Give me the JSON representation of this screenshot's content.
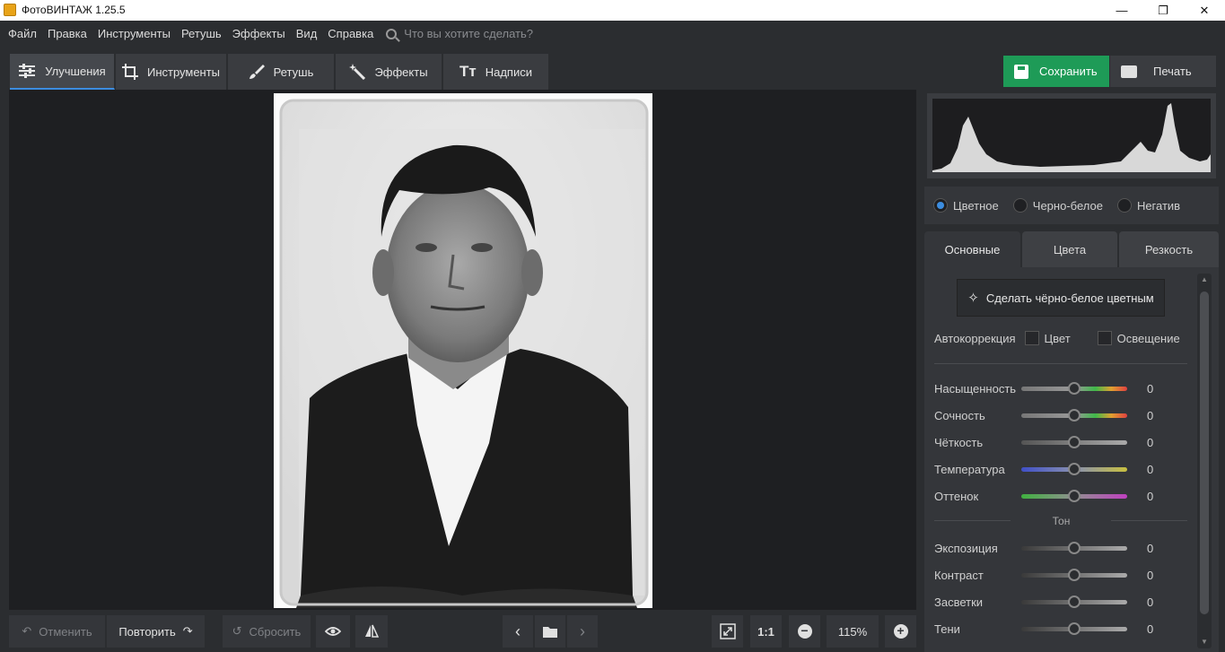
{
  "window": {
    "title": "ФотоВИНТАЖ 1.25.5",
    "min_label": "—",
    "max_label": "❐",
    "close_label": "✕"
  },
  "menu": {
    "items": [
      "Файл",
      "Правка",
      "Инструменты",
      "Ретушь",
      "Эффекты",
      "Вид",
      "Справка"
    ],
    "search_placeholder": "Что вы хотите сделать?"
  },
  "tabs": [
    {
      "label": "Улучшения",
      "icon": "sliders-icon"
    },
    {
      "label": "Инструменты",
      "icon": "crop-icon"
    },
    {
      "label": "Ретушь",
      "icon": "brush-icon"
    },
    {
      "label": "Эффекты",
      "icon": "magic-wand-icon"
    },
    {
      "label": "Надписи",
      "icon": "text-icon"
    }
  ],
  "actions": {
    "save": "Сохранить",
    "print": "Печать"
  },
  "bottom": {
    "undo": "Отменить",
    "redo": "Повторить",
    "reset": "Сбросить",
    "ratio": "1:1",
    "zoom": "115%"
  },
  "color_mode": {
    "options": [
      "Цветное",
      "Черно-белое",
      "Негатив"
    ],
    "selected": "Цветное"
  },
  "panel_tabs": [
    "Основные",
    "Цвета",
    "Резкость"
  ],
  "colorize_button": "Сделать чёрно-белое цветным",
  "autocorrection": {
    "label": "Автокоррекция",
    "color": "Цвет",
    "light": "Освещение"
  },
  "sliders_main": [
    {
      "label": "Насыщенность",
      "value": "0"
    },
    {
      "label": "Сочность",
      "value": "0"
    },
    {
      "label": "Чёткость",
      "value": "0"
    },
    {
      "label": "Температура",
      "value": "0"
    },
    {
      "label": "Оттенок",
      "value": "0"
    }
  ],
  "tone_title": "Тон",
  "sliders_tone": [
    {
      "label": "Экспозиция",
      "value": "0"
    },
    {
      "label": "Контраст",
      "value": "0"
    },
    {
      "label": "Засветки",
      "value": "0"
    },
    {
      "label": "Тени",
      "value": "0"
    }
  ],
  "colors": {
    "accent": "#3c8de0",
    "save_green": "#1e9b57"
  }
}
